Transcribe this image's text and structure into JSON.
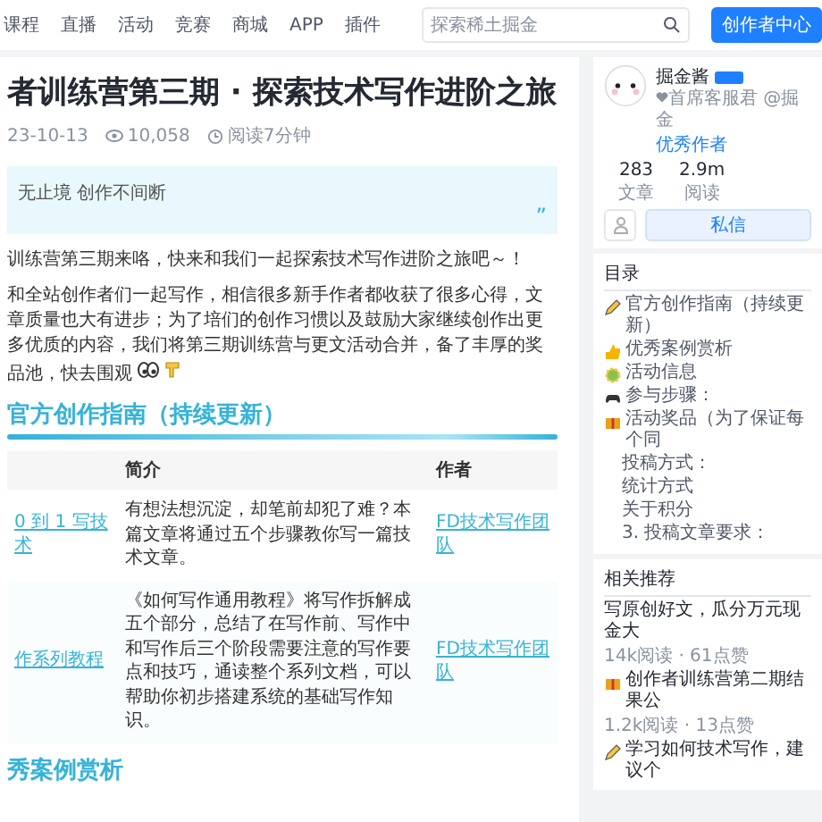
{
  "nav": {
    "links": [
      "课程",
      "直播",
      "活动",
      "竞赛",
      "商城",
      "APP",
      "插件"
    ],
    "search": {
      "placeholder": "探索稀土掘金"
    },
    "cta": "创作者中心"
  },
  "article": {
    "title": "者训练营第三期 · 探索技术写作进阶之旅",
    "meta": {
      "date": "23-10-13",
      "views": "10,058",
      "read_time": "阅读7分钟"
    },
    "quote": "无止境 创作不间断",
    "quote_mark": "”",
    "paragraphs": [
      {
        "text": "训练营第三期来咯，快来和我们一起探索技术写作进阶之旅吧～！",
        "kind": "plain"
      },
      {
        "text": "和全站创作者们一起写作，相信很多新手作者都收获了很多心得，文章质量也大有进步；为了培们的创作习惯以及鼓励大家继续创作出更多优质的内容，我们将第三期训练营与更文活动合并，备了丰厚的奖品池，快去围观",
        "kind": "emoji"
      }
    ],
    "sections": [
      {
        "heading": "官方创作指南（持续更新）",
        "table": {
          "columns": [
            "简介",
            "作者"
          ],
          "rows": [
            {
              "title": "0 到 1 写技术",
              "intro": "有想法想沉淀，却笔前却犯了难？本篇文章将通过五个步骤教你写一篇技术文章。",
              "author": "FD技术写作团队"
            },
            {
              "title": "作系列教程",
              "intro": "《如何写作通用教程》将写作拆解成五个部分，总结了在写作前、写作中和写作后三个阶段需要注意的写作要点和技巧，通读整个系列文档，可以帮助你初步搭建系统的基础写作知识。",
              "author": "FD技术写作团队"
            }
          ]
        }
      },
      {
        "heading": "秀案例赏析"
      }
    ]
  },
  "author": {
    "name": "掘金酱",
    "subtitle": "首席客服君 @掘金",
    "tag": "优秀作者",
    "stats": [
      {
        "value": "283",
        "label": "文章"
      },
      {
        "value": "2.9m",
        "label": "阅读"
      }
    ],
    "message": "私信"
  },
  "toc": {
    "title": "目录",
    "items": [
      {
        "label": "官方创作指南（持续更新）",
        "kind": "pencil"
      },
      {
        "label": "优秀案例赏析",
        "kind": "thumbs"
      },
      {
        "label": "活动信息",
        "kind": "gear"
      },
      {
        "label": "参与步骤：",
        "kind": "gamepad"
      },
      {
        "label": "活动奖品（为了保证每个同",
        "kind": "gift",
        "children": [
          {
            "label": "投稿方式："
          },
          {
            "label": "统计方式"
          },
          {
            "label": "关于积分"
          },
          {
            "label": "3. 投稿文章要求："
          }
        ]
      }
    ]
  },
  "related": {
    "title": "相关推荐",
    "items": [
      {
        "title": "写原创好文，瓜分万元现金大",
        "meta": "14k阅读 · 61点赞",
        "kind": "none"
      },
      {
        "title": "创作者训练营第二期结果公",
        "meta": "1.2k阅读 · 13点赞",
        "kind": "gift"
      },
      {
        "title": "学习如何技术写作，建议个",
        "kind": "pencil"
      }
    ]
  }
}
